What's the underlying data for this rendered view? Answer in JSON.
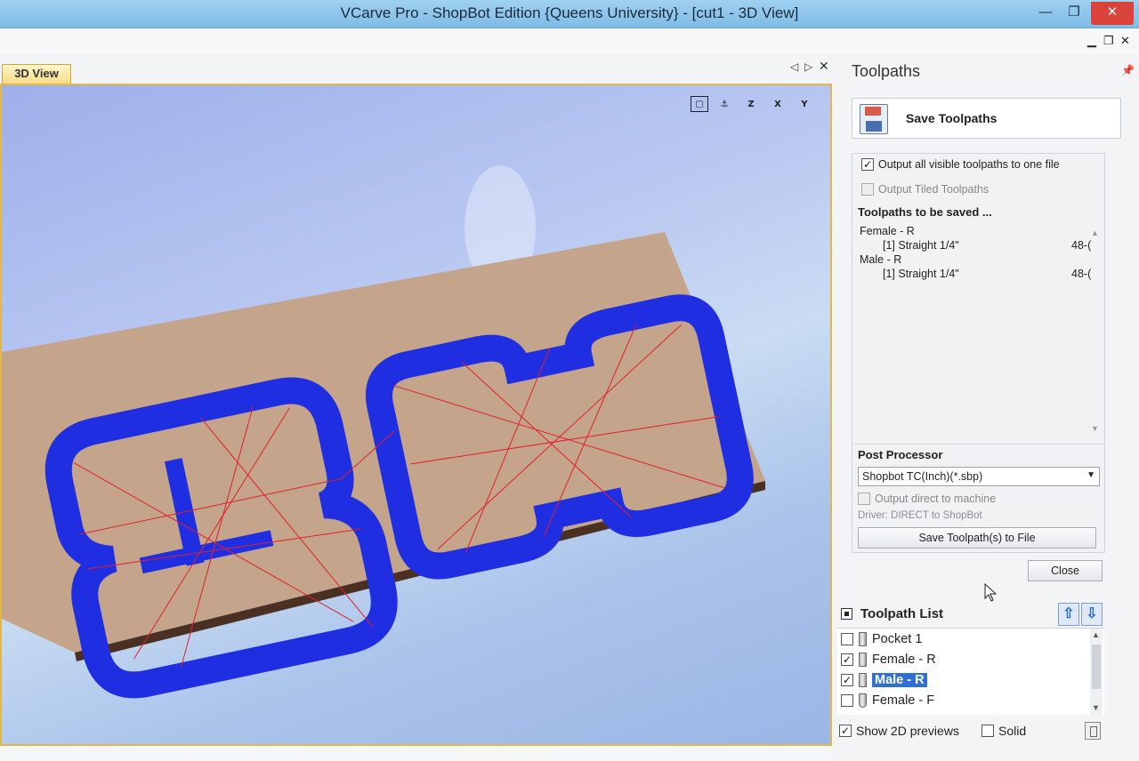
{
  "window": {
    "title": "VCarve Pro - ShopBot Edition {Queens University} - [cut1 - 3D View]"
  },
  "document": {
    "tab_label": "3D View"
  },
  "view_toolbar": {
    "z_label": "Z",
    "x_label": "X",
    "y_label": "Y"
  },
  "panel": {
    "title": "Toolpaths",
    "save_header_label": "Save Toolpaths",
    "output_all_label": "Output all visible toolpaths to one file",
    "output_all_checked": true,
    "output_tiled_label": "Output Tiled Toolpaths",
    "to_be_saved_heading": "Toolpaths to be saved ...",
    "to_be_saved": [
      {
        "group": "Female - R",
        "tool": "[1] Straight 1/4\"",
        "size": "48-("
      },
      {
        "group": "Male - R",
        "tool": "[1] Straight 1/4\"",
        "size": "48-("
      }
    ],
    "post_processor_heading": "Post Processor",
    "post_processor_value": "Shopbot TC(Inch)(*.sbp)",
    "output_direct_label": "Output direct to machine",
    "driver_text": "Driver: DIRECT to ShopBot",
    "save_file_button": "Save Toolpath(s) to File",
    "close_button": "Close"
  },
  "toolpath_list": {
    "heading": "Toolpath List",
    "items": [
      {
        "name": "Pocket 1",
        "checked": false,
        "selected": false,
        "tool": "straight"
      },
      {
        "name": "Female - R",
        "checked": true,
        "selected": false,
        "tool": "straight"
      },
      {
        "name": "Male - R",
        "checked": true,
        "selected": true,
        "tool": "straight"
      },
      {
        "name": "Female - F",
        "checked": false,
        "selected": false,
        "tool": "ball"
      }
    ],
    "show_2d_label": "Show 2D previews",
    "show_2d_checked": true,
    "solid_label": "Solid",
    "solid_checked": false
  },
  "colors": {
    "toolpath_blue": "#1f2ee0",
    "rapid_red": "#e0202a",
    "material": "#c4a48a",
    "accent_select": "#2f6fd6"
  }
}
